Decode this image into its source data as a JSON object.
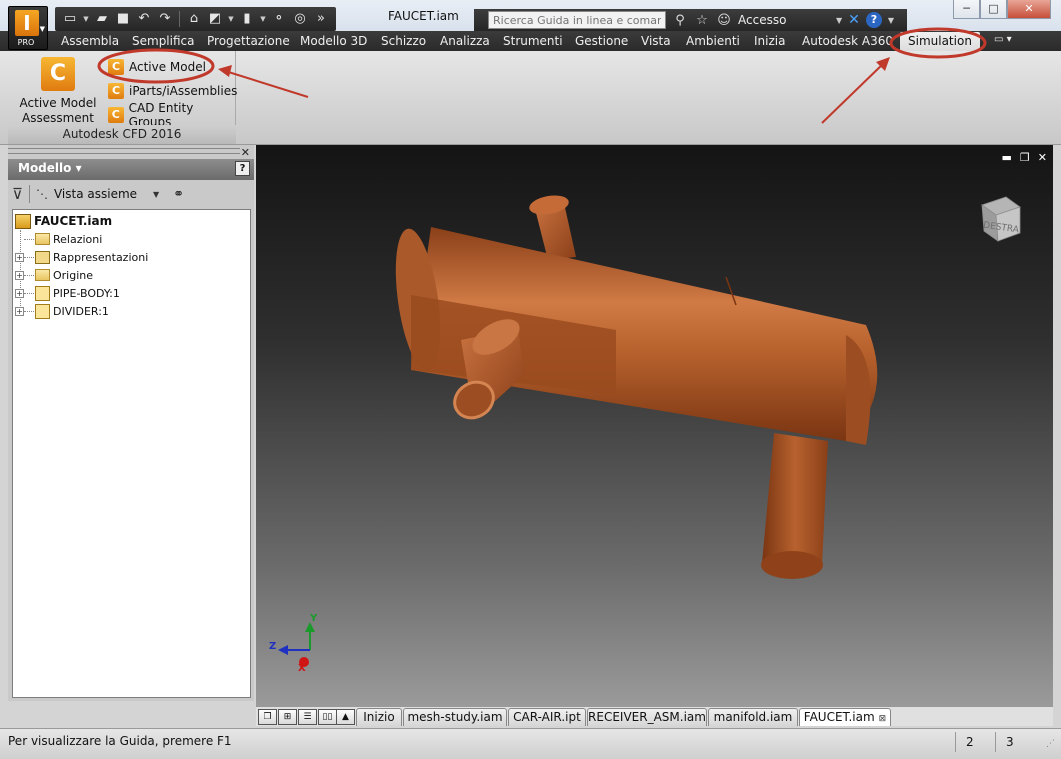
{
  "app": {
    "logo_letter": "I",
    "edition": "PRO",
    "document_title": "FAUCET.iam"
  },
  "search": {
    "placeholder": "Ricerca Guida in linea e comand"
  },
  "account": {
    "login_label": "Accesso"
  },
  "ribbon_tabs": [
    {
      "label": "Assembla"
    },
    {
      "label": "Semplifica"
    },
    {
      "label": "Progettazione"
    },
    {
      "label": "Modello 3D"
    },
    {
      "label": "Schizzo"
    },
    {
      "label": "Analizza"
    },
    {
      "label": "Strumenti"
    },
    {
      "label": "Gestione"
    },
    {
      "label": "Vista"
    },
    {
      "label": "Ambienti"
    },
    {
      "label": "Inizia"
    },
    {
      "label": "Autodesk A360"
    },
    {
      "label": "Simulation",
      "active": true
    }
  ],
  "ribbon_panel": {
    "big_button_line1": "Active Model",
    "big_button_line2": "Assessment Tool",
    "small_buttons": [
      {
        "label": "Active Model"
      },
      {
        "label": "iParts/iAssemblies"
      },
      {
        "label": "CAD Entity Groups"
      }
    ],
    "panel_title": "Autodesk CFD 2016",
    "icon_letter": "C"
  },
  "browser": {
    "title": "Modello ▾",
    "view_label": "Vista assieme",
    "help_label": "?",
    "tree": [
      {
        "label": "FAUCET.iam",
        "type": "assembly",
        "root": true
      },
      {
        "label": "Relazioni",
        "type": "folder",
        "expand": ""
      },
      {
        "label": "Rappresentazioni",
        "type": "representations",
        "expand": "+"
      },
      {
        "label": "Origine",
        "type": "folder",
        "expand": "+"
      },
      {
        "label": "PIPE-BODY:1",
        "type": "part",
        "expand": "+"
      },
      {
        "label": "DIVIDER:1",
        "type": "part",
        "expand": "+"
      }
    ]
  },
  "viewport": {
    "viewcube_face": "DESTRA",
    "triad_labels": {
      "y": "Y",
      "z": "Z",
      "x": "X"
    },
    "model_color": "#b8622e"
  },
  "document_tabs": [
    {
      "label": "Inizio"
    },
    {
      "label": "mesh-study.iam"
    },
    {
      "label": "CAR-AIR.ipt"
    },
    {
      "label": "RECEIVER_ASM.iam"
    },
    {
      "label": "manifold.iam"
    },
    {
      "label": "FAUCET.iam",
      "active": true
    }
  ],
  "status": {
    "help_text": "Per visualizzare la Guida, premere F1",
    "count_a": "2",
    "count_b": "3"
  },
  "colors": {
    "highlight_annotation": "#c0392b",
    "ribbon_dark": "#2a2a2a",
    "accent_orange": "#e07b10"
  }
}
